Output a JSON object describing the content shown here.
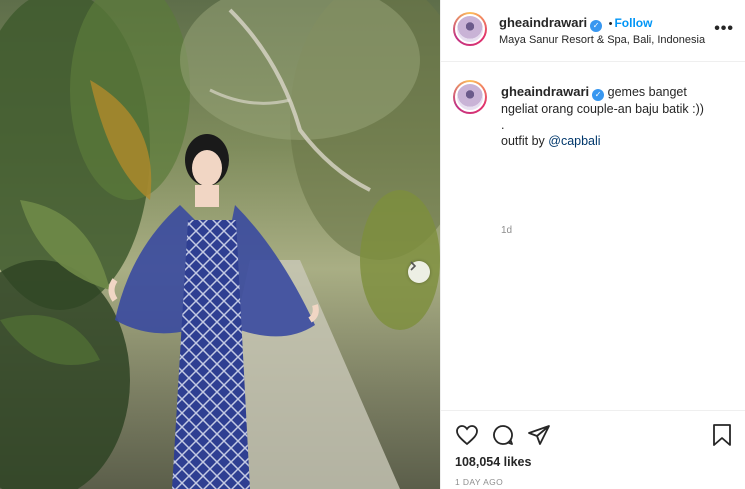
{
  "post": {
    "username": "gheaindrawari",
    "follow_label": "Follow",
    "separator": "•",
    "location": "Maya Sanur Resort & Spa, Bali, Indonesia",
    "more_label": "•••"
  },
  "caption": {
    "username": "gheaindrawari",
    "line1": "gemes banget",
    "line2": "ngeliat orang couple-an baju batik :))",
    "line3": ".",
    "line4_prefix": "outfit by ",
    "mention": "@capbali",
    "time_ago": "1d"
  },
  "actions": {
    "likes": "108,054 likes",
    "date": "1 DAY AGO"
  },
  "icons": [
    "heart-icon",
    "comment-icon",
    "share-icon",
    "bookmark-icon",
    "chevron-right-icon",
    "verified-icon",
    "more-icon"
  ],
  "colors": {
    "accent": "#0095f6",
    "verified": "#3897f0",
    "batik": "#3a4aa0"
  }
}
